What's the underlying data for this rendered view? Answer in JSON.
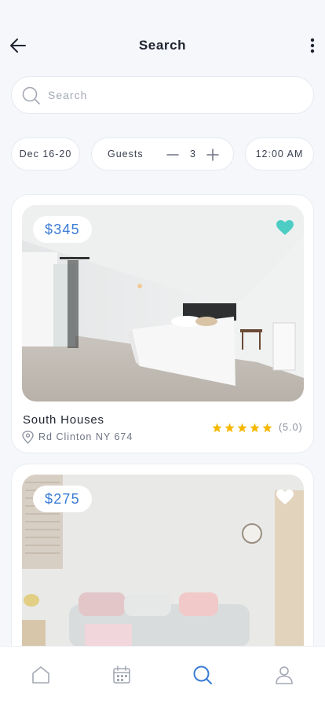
{
  "header": {
    "title": "Search"
  },
  "search": {
    "placeholder": "Search",
    "value": ""
  },
  "filters": {
    "date": "Dec 16-20",
    "guests_label": "Guests",
    "guests_count": "3",
    "time": "12:00 AM"
  },
  "listings": [
    {
      "price": "$345",
      "name": "South Houses",
      "location": "Rd Clinton NY 674",
      "rating": "(5.0)",
      "stars": 5,
      "favorited": true
    },
    {
      "price": "$275",
      "favorited": false
    }
  ],
  "tabs": [
    {
      "icon": "home-icon",
      "active": false
    },
    {
      "icon": "calendar-icon",
      "active": false
    },
    {
      "icon": "search-icon",
      "active": true
    },
    {
      "icon": "profile-icon",
      "active": false
    }
  ],
  "colors": {
    "accent": "#3a7bd5",
    "favorite": "#4ecdc4",
    "star": "#f5b800",
    "background": "#f5f7fb"
  }
}
